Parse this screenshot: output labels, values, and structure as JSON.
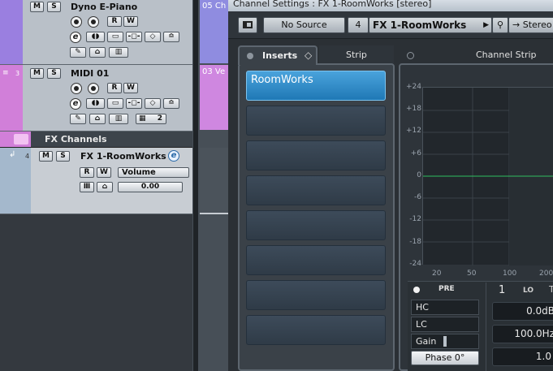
{
  "tracks": {
    "dyno": {
      "name": "Dyno E-Piano",
      "m": "M",
      "s": "S",
      "r": "R",
      "w": "W",
      "e": "e"
    },
    "midi": {
      "name": "MIDI 01",
      "number": "3",
      "m": "M",
      "s": "S",
      "r": "R",
      "w": "W",
      "e": "e",
      "channel": "2"
    },
    "folder": {
      "name": "FX Channels"
    },
    "fx": {
      "name": "FX 1-RoomWorks",
      "number": "4",
      "m": "M",
      "s": "S",
      "r": "R",
      "w": "W",
      "e": "e",
      "automation_param": "Volume",
      "volume_value": "0.00"
    }
  },
  "events": {
    "event1": "05 Ch",
    "event2": "03 Ve"
  },
  "window": {
    "title": "Channel Settings : FX 1-RoomWorks [stereo]",
    "source": "No Source",
    "channel_number": "4",
    "channel_name": "FX 1-RoomWorks",
    "output": "Stereo"
  },
  "tabs": {
    "inserts": "Inserts",
    "strip": "Strip",
    "channel_strip": "Channel Strip"
  },
  "inserts": {
    "slot1": "RoomWorks"
  },
  "eq": {
    "y_ticks": [
      "+24",
      "+18",
      "+12",
      "+6",
      "0",
      "-6",
      "-12",
      "-18",
      "-24"
    ],
    "x_ticks": [
      "20",
      "50",
      "100",
      "200"
    ],
    "pre": "PRE",
    "hc": "HC",
    "lc": "LC",
    "gain": "Gain",
    "phase": "Phase 0°",
    "band_number": "1",
    "band_type": "LO",
    "gain_value": "0.0dB",
    "freq_value": "100.0Hz",
    "q_value": "1.0"
  },
  "colors": {
    "accent_blue": "#2a8ac4",
    "track_purple": "#9a7fe0",
    "track_pink": "#d17fd9",
    "eq_line": "#2fbf5f"
  }
}
